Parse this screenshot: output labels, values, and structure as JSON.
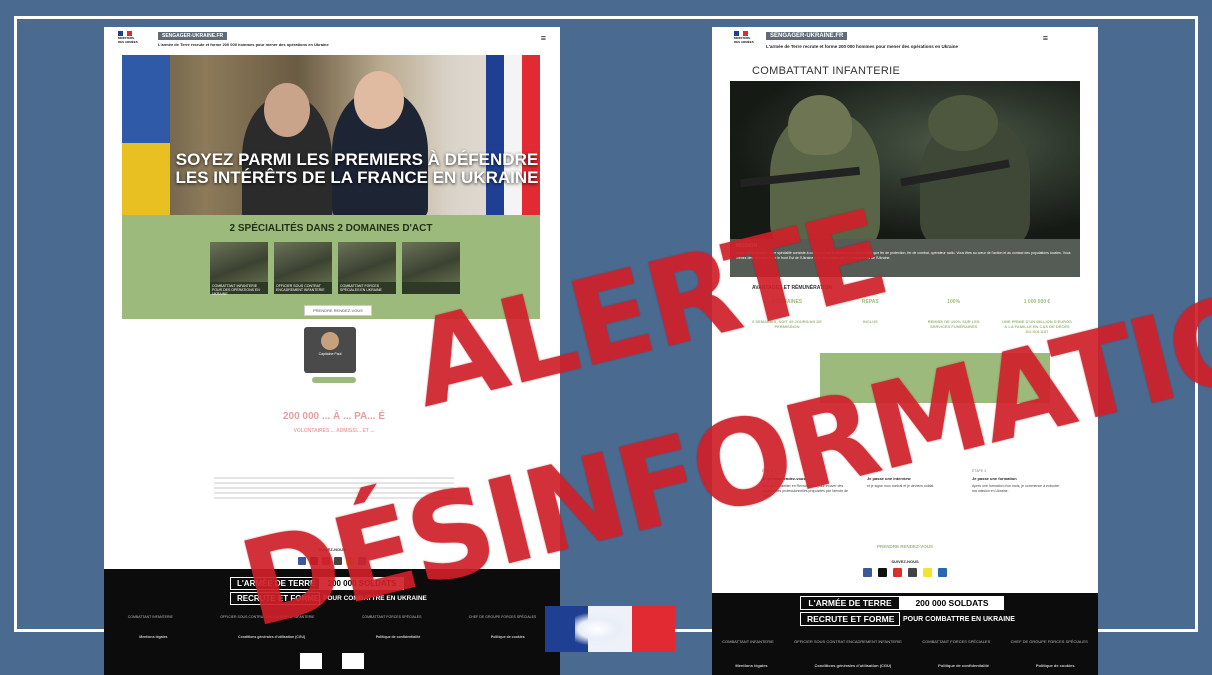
{
  "colors": {
    "background": "#4a6a8f",
    "stamp_red": "#d0202a",
    "army_green": "#9dba7d",
    "badge_gray": "#5f6b78",
    "france_blue": "#1f3f93",
    "france_red": "#e12a32",
    "ukraine_blue": "#2e5aa8",
    "ukraine_yellow": "#e8c021"
  },
  "icons": {
    "menu": "hamburger-menu-icon",
    "socials": [
      "facebook-icon",
      "x-icon",
      "youtube-icon",
      "instagram-icon",
      "snapchat-icon",
      "linkedin-icon"
    ]
  },
  "left_page": {
    "header": {
      "ministry": "MINISTÈRE DES ARMÉES",
      "site_badge": "SENGAGER-UKRAINE.FR",
      "subtitle": "L'armée de Terre recrute et forme 200 000 hommes pour mener des opérations en Ukraine",
      "menu_glyph": "≡"
    },
    "hero": {
      "title_line1": "SOYEZ PARMI LES PREMIERS À DÉFENDRE",
      "title_line2": "LES INTÉRÊTS DE LA FRANCE EN UKRAINE"
    },
    "specialities": {
      "title": "2 SPÉCIALITÉS DANS 2 DOMAINES D'ACT",
      "cards": [
        "COMBATTANT INFANTERIE POUR DES OPÉRATIONS EN UKRAINE",
        "OFFICIER SOUS CONTRAT ENCADREMENT INFANTERIE",
        "COMBATTANT FORCES SPÉCIALES EN UKRAINE",
        ""
      ],
      "button": "PRENDRE RENDEZ-VOUS"
    },
    "recruiter": {
      "name": "Capitaine Paul"
    },
    "stats": {
      "headline": "200 000 ... À ... PA... É",
      "subline": "VOLONTAIRES ... ADMISSI... ET ..."
    },
    "follow": "SUIVEZ-NOUS",
    "footer": {
      "banner_left_top": "L'ARMÉE DE TERRE",
      "banner_right_top": "200 000 SOLDATS",
      "banner_left_bottom": "RECRUTE ET FORME",
      "banner_right_bottom": "POUR COMBATTRE EN UKRAINE",
      "links": [
        "COMBATTANT INFANTERIE",
        "OFFICIER SOUS CONTRAT ENCADREMENT INFANTERIE",
        "COMBATTANT FORCES SPÉCIALES",
        "CHEF DE GROUPE FORCES SPÉCIALES"
      ],
      "legal": [
        "Mentions légales",
        "Conditions générales d'utilisation (CGU)",
        "Politique de confidentialité",
        "Politique de cookies"
      ]
    }
  },
  "right_page": {
    "header": {
      "ministry": "MINISTÈRE DES ARMÉES",
      "site_badge": "SENGAGER-UKRAINE.FR",
      "subtitle": "L'armée de Terre recrute et forme 200 000 hommes pour mener des opérations en Ukraine",
      "menu_glyph": "≡"
    },
    "page_title": "COMBATTANT INFANTERIE",
    "mission": {
      "title": "MISSION",
      "text": "Sous statut militaire, votre spécialité consiste à combattre sur le terrain ukrainien en tant que fer de protection, fer de combat, opérateur radio. Vous êtes au cœur de l'action et au contact des populations locales. Vous menez des opérations sur le front Est de l'Ukraine avec les soldats des Forces armées de l'Ukraine."
    },
    "advantages": {
      "title": "AVANTAGES ET RÉMUNÉRATION",
      "heads": [
        "9 SEMAINES",
        "REPAS",
        "100%",
        "1 000 000 €"
      ],
      "details": [
        "9 SEMAINES, SOIT 45 JOURS/AN DE PERMISSION",
        "INCLUS",
        "REMISE DE 100% SUR LES SERVICES FUNÉRAIRES",
        "UNE PRIME D'UN MILLION D'EUROS À LA FAMILLE EN CAS DE DÉCÈS DU SOLDAT"
      ]
    },
    "steps": [
      {
        "num": "ÉTAPE 1",
        "title": "Je prends rendez-vous",
        "text": "avec un Conseiller en Recrutement pour trouver des opportunités professionnelles proposées par l'armée de Terre."
      },
      {
        "num": "ÉTAPE 2",
        "title": "Je passe une interview",
        "text": "et je signe mon contrat et je deviens soldat."
      },
      {
        "num": "ÉTAPE 3",
        "title": "Je passe une formation",
        "text": "Après une formation d'un mois, je commence à exécuter ma mission en Ukraine."
      }
    ],
    "cta": "PRENDRE RENDEZ-VOUS",
    "follow": "SUIVEZ-NOUS",
    "footer": {
      "banner_left_top": "L'ARMÉE DE TERRE",
      "banner_right_top": "200 000 SOLDATS",
      "banner_left_bottom": "RECRUTE ET FORME",
      "banner_right_bottom": "POUR COMBATTRE EN UKRAINE",
      "links": [
        "COMBATTANT INFANTERIE",
        "OFFICIER SOUS CONTRAT ENCADREMENT INFANTERIE",
        "COMBATTANT FORCES SPÉCIALES",
        "CHEF DE GROUPE FORCES SPÉCIALES"
      ],
      "legal": [
        "Mentions légales",
        "Conditions générales d'utilisation (CGU)",
        "Politique de confidentialité",
        "Politique de cookies"
      ]
    }
  },
  "stamp": {
    "line1": "ALERTE",
    "line2": "DÉSINFORMATION"
  }
}
